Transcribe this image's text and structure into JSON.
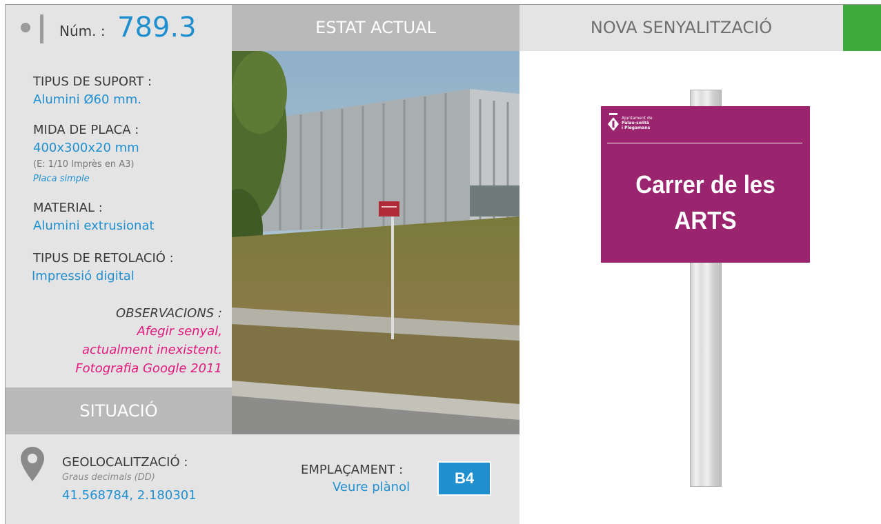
{
  "header": {
    "num_label": "Núm. :",
    "num_value": "789.3",
    "estat_actual": "ESTAT ACTUAL",
    "nova_senyalitzacio": "NOVA SENYALITZACIÓ",
    "accent_color": "#3eaa3e"
  },
  "info": {
    "suport_label": "TIPUS DE SUPORT :",
    "suport_value": "Alumini Ø60 mm.",
    "mida_label": "MIDA DE PLACA :",
    "mida_value": "400x300x20 mm",
    "mida_scale": "(E: 1/10 Imprès en A3)",
    "mida_type": "Placa simple",
    "material_label": "MATERIAL :",
    "material_value": "Alumini extrusionat",
    "retolacio_label": "TIPUS DE RETOLACIÓ :",
    "retolacio_value": "Impressió digital",
    "observacions_label": "OBSERVACIONS :",
    "observacions_lines": [
      "Afegir senyal,",
      "actualment inexistent.",
      "Fotografia Google 2011"
    ]
  },
  "situacio": {
    "label": "SITUACIÓ"
  },
  "location": {
    "geo_label": "GEOLOCALITZACIÓ :",
    "geo_format": "Graus decimals (DD)",
    "geo_value": "41.568784, 2.180301",
    "emplacament_label": "EMPLAÇAMENT :",
    "emplacament_link": "Veure plànol",
    "emplacament_code": "B4"
  },
  "sign": {
    "org_lines": [
      "Ajuntament de",
      "Palau-solità",
      "i Plegamans"
    ],
    "street_lines": [
      "Carrer de les",
      "ARTS"
    ],
    "plate_color": "#9b246f"
  },
  "colors": {
    "accent_blue": "#1f8fd0",
    "observation_pink": "#e0197d",
    "panel_gray": "#e4e4e4",
    "header_gray": "#b9b9b9"
  }
}
